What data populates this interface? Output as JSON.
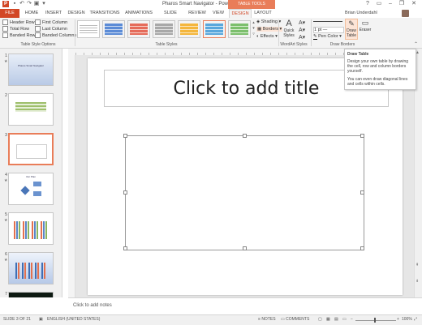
{
  "titlebar": {
    "title": "Pharos Smart Navigator - PowerPoint",
    "table_tools": "TABLE TOOLS",
    "app_icon": "P",
    "qat": [
      "save-icon",
      "undo-icon",
      "redo-icon",
      "present-icon",
      "customize-icon"
    ],
    "window_buttons": [
      "help-icon",
      "ribbon-display-icon",
      "minimize-icon",
      "restore-icon",
      "close-icon"
    ]
  },
  "tabs": [
    "FILE",
    "HOME",
    "INSERT",
    "DESIGN",
    "TRANSITIONS",
    "ANIMATIONS",
    "SLIDE SHOW",
    "REVIEW",
    "VIEW",
    "DESIGN",
    "LAYOUT"
  ],
  "active_tab_index": 9,
  "user": {
    "name": "Brian Underdahl"
  },
  "ribbon": {
    "style_options": {
      "col1": [
        "Header Row",
        "Total Row",
        "Banded Rows"
      ],
      "col2": [
        "First Column",
        "Last Column",
        "Banded Columns"
      ],
      "checked": [
        "Header Row",
        "Banded Rows"
      ],
      "label": "Table Style Options"
    },
    "table_styles": {
      "label": "Table Styles"
    },
    "shading": "Shading",
    "borders": "Borders",
    "effects": "Effects",
    "quick_styles": "Quick Styles",
    "wordart_label": "WordArt Styles",
    "pen_weight": "1 pt",
    "pen_color": "Pen Color",
    "draw_table": "Draw Table",
    "eraser": "Eraser",
    "draw_borders_label": "Draw Borders"
  },
  "tooltip": {
    "title": "Draw Table",
    "line1": "Design your own table by drawing the cell, row and column borders yourself.",
    "line2": "You can even draw diagonal lines and cells within cells."
  },
  "slides": [
    {
      "num": "1",
      "title": "Pharos Smart Navigator"
    },
    {
      "num": "2"
    },
    {
      "num": "3"
    },
    {
      "num": "4",
      "title": "Our Plan"
    },
    {
      "num": "5"
    },
    {
      "num": "6"
    },
    {
      "num": "7"
    }
  ],
  "slide": {
    "title_placeholder": "Click to add title"
  },
  "notes": {
    "placeholder": "Click to add notes"
  },
  "status": {
    "slide": "SLIDE 3 OF 21",
    "language": "ENGLISH (UNITED STATES)",
    "notes": "NOTES",
    "comments": "COMMENTS",
    "zoom": "100%"
  },
  "colors": {
    "accent": "#d24726",
    "table_tools": "#e97d59"
  }
}
